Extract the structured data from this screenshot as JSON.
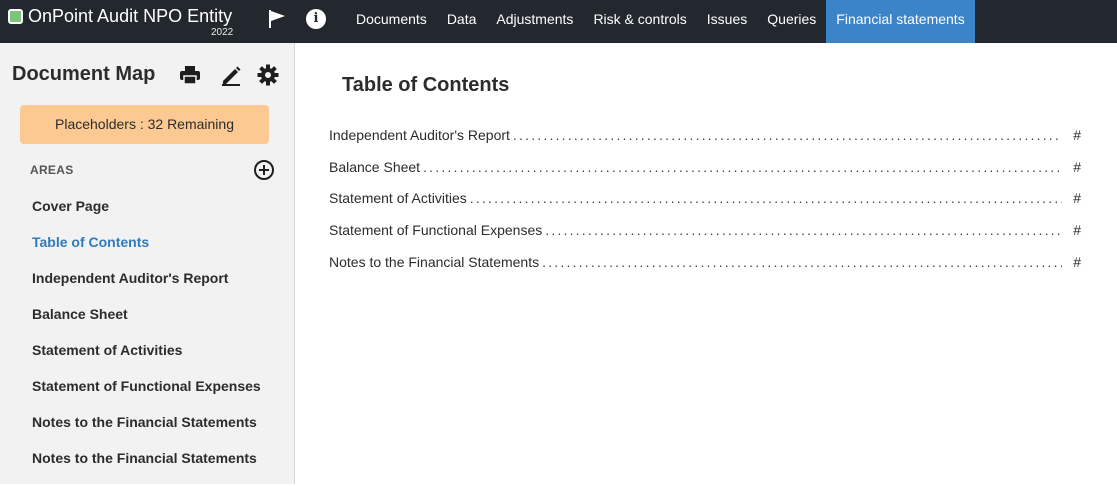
{
  "app": {
    "name": "OnPoint Audit NPO Entity",
    "year": "2022"
  },
  "nav": {
    "tabs": [
      {
        "label": "Documents"
      },
      {
        "label": "Data"
      },
      {
        "label": "Adjustments"
      },
      {
        "label": "Risk & controls"
      },
      {
        "label": "Issues"
      },
      {
        "label": "Queries"
      },
      {
        "label": "Financial statements",
        "active": true
      }
    ]
  },
  "sidebar": {
    "title": "Document Map",
    "placeholders_label": "Placeholders : 32 Remaining",
    "areas_label": "AREAS",
    "items": [
      {
        "label": "Cover Page"
      },
      {
        "label": "Table of Contents",
        "active": true
      },
      {
        "label": "Independent Auditor's Report"
      },
      {
        "label": "Balance Sheet"
      },
      {
        "label": "Statement of Activities"
      },
      {
        "label": "Statement of Functional Expenses"
      },
      {
        "label": "Notes to the Financial Statements"
      },
      {
        "label": "Notes to the Financial Statements"
      }
    ]
  },
  "main": {
    "title": "Table of Contents",
    "toc": [
      {
        "label": "Independent Auditor's Report",
        "page": "#"
      },
      {
        "label": "Balance Sheet",
        "page": "#"
      },
      {
        "label": "Statement of Activities",
        "page": "#"
      },
      {
        "label": "Statement of Functional Expenses",
        "page": "#"
      },
      {
        "label": "Notes to the Financial Statements",
        "page": "#"
      }
    ]
  },
  "colors": {
    "topbar": "#23282f",
    "active_tab": "#3c84c8",
    "placeholder_bg": "#fbc991",
    "active_link": "#2f7bbd",
    "app_icon": "#7cc57a"
  },
  "icons": [
    "app-logo-icon",
    "flag-icon",
    "info-icon",
    "printer-icon",
    "pencil-icon",
    "gear-icon",
    "add-circle-icon"
  ]
}
